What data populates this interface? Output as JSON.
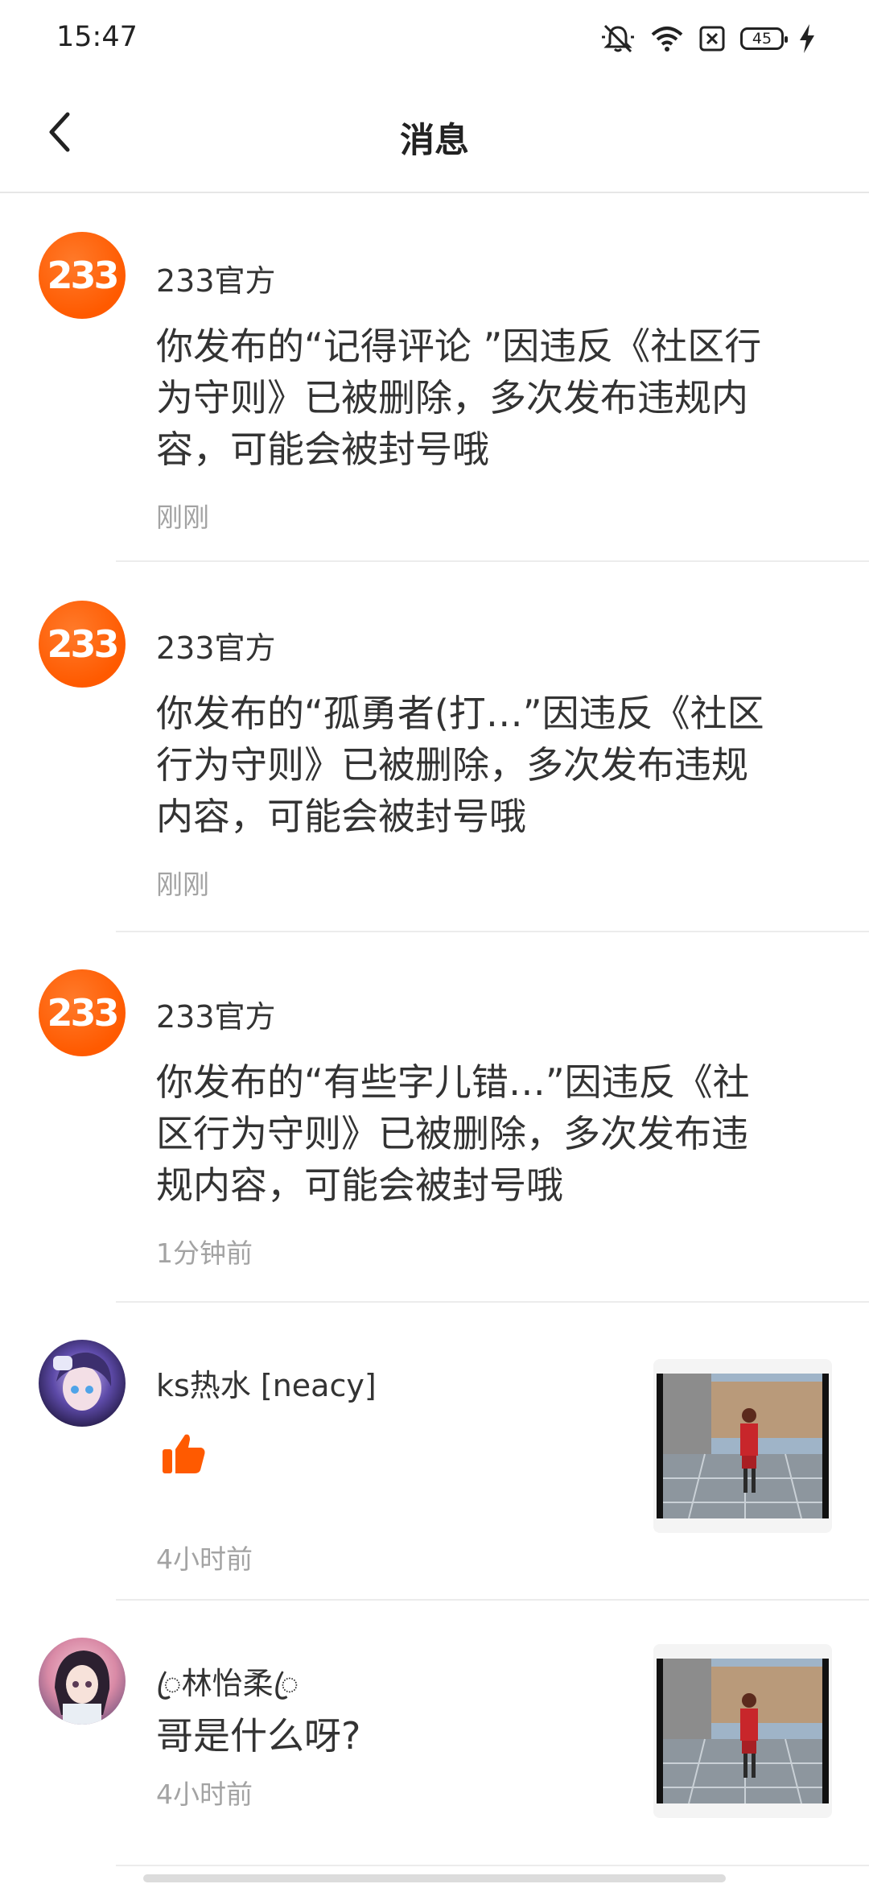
{
  "status": {
    "time": "15:47",
    "battery": "45",
    "icons": [
      "mute-bell-icon",
      "wifi-icon",
      "sim-error-icon",
      "battery-icon",
      "charging-bolt-icon"
    ]
  },
  "header": {
    "title": "消息",
    "back_icon": "chevron-left-icon"
  },
  "messages": [
    {
      "sender": "233官方",
      "avatar_text": "233",
      "content": "你发布的“记得评论 ”因违反《社区行为守则》已被删除，多次发布违规内容，可能会被封号哦",
      "time": "刚刚"
    },
    {
      "sender": "233官方",
      "avatar_text": "233",
      "content": "你发布的“孤勇者(打…”因违反《社区行为守则》已被删除，多次发布违规内容，可能会被封号哦",
      "time": "刚刚"
    },
    {
      "sender": "233官方",
      "avatar_text": "233",
      "content": "你发布的“有些字儿错…”因违反《社区行为守则》已被删除，多次发布违规内容，可能会被封号哦",
      "time": "1分钟前"
    },
    {
      "sender": "ks热水 [neacy]",
      "content_icon": "thumbs-up-icon",
      "time": "4小时前"
    },
    {
      "sender": "ꦿ林怡柔ꦿ",
      "content": "哥是什么呀?",
      "time": "4小时前"
    }
  ],
  "colors": {
    "accent": "#ff5a00",
    "divider": "#ececec",
    "time_text": "#a3a3a3"
  }
}
